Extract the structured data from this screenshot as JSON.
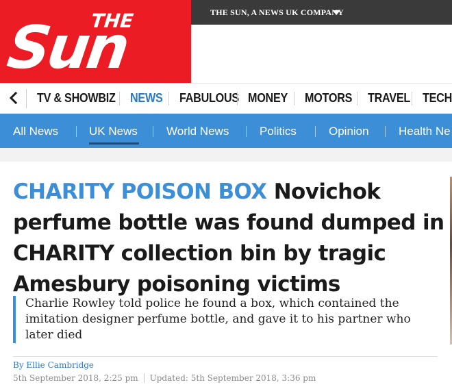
{
  "brand": {
    "logo_the": "THE",
    "logo_sun": "Sun",
    "company_label": "THE SUN, A NEWS UK COMPANY",
    "brand_red": "#eb1c24",
    "accent_blue": "#3c8fd6"
  },
  "section_nav": {
    "back_icon": "chevron-left-icon",
    "items": [
      {
        "label": "TV & SHOWBIZ",
        "active": false
      },
      {
        "label": "NEWS",
        "active": true
      },
      {
        "label": "FABULOUS",
        "active": false
      },
      {
        "label": "MONEY",
        "active": false
      },
      {
        "label": "MOTORS",
        "active": false
      },
      {
        "label": "TRAVEL",
        "active": false
      },
      {
        "label": "TECH",
        "active": false
      }
    ]
  },
  "sub_nav": {
    "items": [
      {
        "label": "All News",
        "active": false
      },
      {
        "label": "UK News",
        "active": true
      },
      {
        "label": "World News",
        "active": false
      },
      {
        "label": "Politics",
        "active": false
      },
      {
        "label": "Opinion",
        "active": false
      },
      {
        "label": "Health Ne",
        "active": false
      }
    ]
  },
  "article": {
    "kicker": "CHARITY POISON BOX",
    "headline": "Novichok perfume bottle was found dumped in CHARITY collection bin by tragic Amesbury poisoning victims",
    "standfirst": "Charlie Rowley told police he found a box, which contained the imitation designer perfume bottle, and gave it to his partner who later died",
    "byline": "By Ellie Cambridge",
    "published": "5th September 2018, 2:25 pm",
    "updated": "Updated: 5th September 2018, 3:36 pm"
  }
}
